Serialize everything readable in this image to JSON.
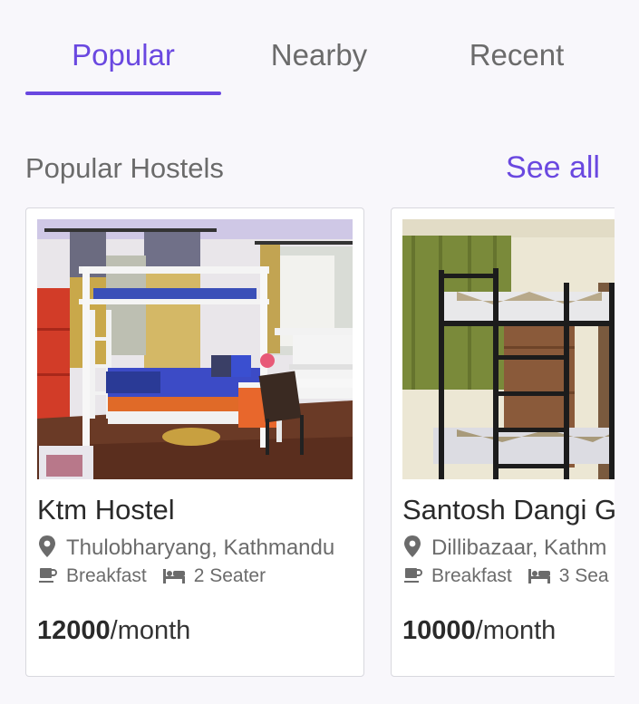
{
  "tabs": [
    {
      "label": "Popular",
      "active": true
    },
    {
      "label": "Nearby",
      "active": false
    },
    {
      "label": "Recent",
      "active": false
    }
  ],
  "section": {
    "title": "Popular Hostels",
    "see_all": "See all"
  },
  "hostels": [
    {
      "name": "Ktm Hostel",
      "location": "Thulobharyang, Kathmandu",
      "meal": "Breakfast",
      "seater": "2 Seater",
      "price": "12000",
      "period": "/month",
      "photo_icon": "bunk-bed-room-photo"
    },
    {
      "name": "Santosh Dangi G",
      "location": "Dillibazaar, Kathm",
      "meal": "Breakfast",
      "seater": "3 Sea",
      "price": "10000",
      "period": "/month",
      "photo_icon": "metal-bunk-room-photo"
    }
  ],
  "colors": {
    "accent": "#6a48e0",
    "muted": "#6b6b6b",
    "background": "#f8f7fb"
  },
  "icons": {
    "location": "location-pin-icon",
    "meal": "coffee-cup-icon",
    "seater": "bed-icon"
  }
}
